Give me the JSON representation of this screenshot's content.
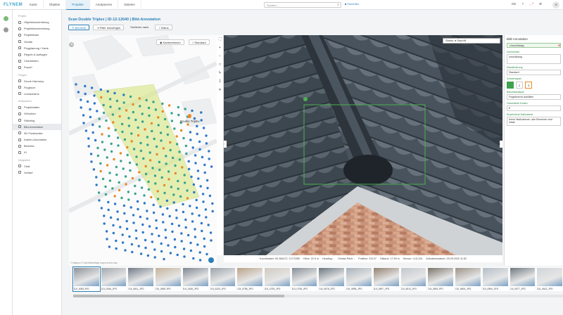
{
  "app": {
    "logo": "FLYNEM"
  },
  "nav": [
    "Karte",
    "Objekte",
    "Projekte",
    "Analysieren",
    "Dateien"
  ],
  "search": {
    "placeholder": "Suchen..."
  },
  "flag": "■ Favoriten",
  "topright": {
    "lang": "DE",
    "badge": "3",
    "avatar": "JE"
  },
  "sidebar": {
    "sections": [
      {
        "header": "Projekt",
        "items": [
          "Objektbeschreibung",
          "Projektbeschreibung",
          "Projektteam",
          "Geräte",
          "Flugplanung / Karte",
          "Regeln & Auflagen",
          "Checklisten",
          "Export"
        ]
      },
      {
        "header": "Fliegen",
        "items": [
          "Drone Harmony",
          "Flugbuch",
          "Livestreams"
        ]
      },
      {
        "header": "Analysieren",
        "items": [
          "Projektdaten",
          "Orthofoto",
          "Stitching",
          "Bild-Annotation",
          "3D Punktwolke",
          "Karten-Annotation",
          "Berichte",
          "KI"
        ]
      },
      {
        "header": "Integration",
        "items": [
          "Chat",
          "Verlauf"
        ]
      }
    ]
  },
  "page": {
    "title": "Scan Double Triplex | ID-12-12640 | Bild-Annotation"
  },
  "toolbar": {
    "btn1": "✎ Bereiche",
    "btn2": "⇥ Filter hinzufügen",
    "btn3": "Sortieren nach",
    "btn4": "↕ Status"
  },
  "map": {
    "btn_karten": "◉ Kartenebenen",
    "btn_stand": "□ Standard",
    "marker_label": "Double Triplex",
    "footer": "© Mapbox © OpenStreetMap Improve this map"
  },
  "photo": {
    "status_text": "Status: ● Geprüft"
  },
  "info": {
    "koord": "Koordinaten: 50.266472, 9.273355",
    "hoehe": "Höhe: 22.5 m",
    "heading": "Heading: -",
    "gimbal": "Gimbal Pitch: -",
    "position": "Position: 224.5°",
    "distanz": "Distanz: 17.59 m",
    "sensor": "Sensor: L1D-20c",
    "datum": "Aufnahmedatum: 25.09.2022 11:52"
  },
  "rpanel": {
    "title": "Bild-Annotation",
    "tag": "Unschlüssig",
    "lbl_note": "Kommentar",
    "note": "unschlüssig",
    "lbl_class": "Klassifizierung",
    "class": "Standard",
    "lbl_sev": "Schweregrad",
    "sev": [
      "",
      "2",
      "3"
    ],
    "lbl_measure": "Berichtsanalyse",
    "measure": "Folgebericht ausfüllen",
    "lbl_cost": "Geschätzte Kosten",
    "cost": "€",
    "lbl_rec": "Empfohlene Maßnahme",
    "rec": "Keine Maßnahmen, alle Elemente sind intakt"
  },
  "colors": {
    "accent": "#2c7fb8",
    "point_blue": "#2f78c8",
    "point_orange": "#e88a26",
    "overlay": "#d9e88a",
    "bbox": "#4caf50"
  },
  "thumbs": [
    "DJI_0053.JPG",
    "DJI_0346_JPG",
    "DJI_0611_JPG",
    "DJI_0692.JPG",
    "DJI_0345_JPG",
    "DJI_0420_JPG",
    "DJI_0758_JPG",
    "DJI_0753_JPG",
    "DJI_0708_JPG",
    "DJI_0678_JPG",
    "DJI_0595_JPG",
    "DJI_0597_JPG",
    "DJI_0813_JPG",
    "DJI_0891.JPG",
    "DJI_0600_JPG",
    "DJI_0594_JPG",
    "DJI_0577_JPG",
    "DJI_0613_JPG"
  ]
}
